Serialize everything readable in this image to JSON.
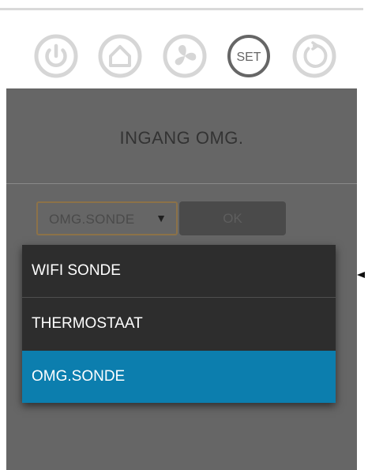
{
  "toolbar": {
    "buttons": [
      {
        "name": "power",
        "icon": "power-icon"
      },
      {
        "name": "home",
        "icon": "home-icon"
      },
      {
        "name": "fan",
        "icon": "fan-icon"
      },
      {
        "name": "set",
        "icon": "set-icon",
        "label": "SET",
        "active": true
      },
      {
        "name": "reset",
        "icon": "refresh-icon"
      }
    ]
  },
  "panel": {
    "title": "INGANG OMG.",
    "select": {
      "value": "OMG.SONDE",
      "arrow": "▼"
    },
    "ok_label": "OK"
  },
  "dropdown": {
    "options": [
      "WIFI SONDE",
      "THERMOSTAAT",
      "OMG.SONDE"
    ],
    "selected": "OMG.SONDE"
  },
  "colors": {
    "panel_bg": "#666666",
    "dropdown_bg": "#2d2d2d",
    "selected_bg": "#0c7eae",
    "icon_inactive": "#d6d6d6",
    "icon_active": "#666666",
    "select_border": "#8c7248"
  }
}
